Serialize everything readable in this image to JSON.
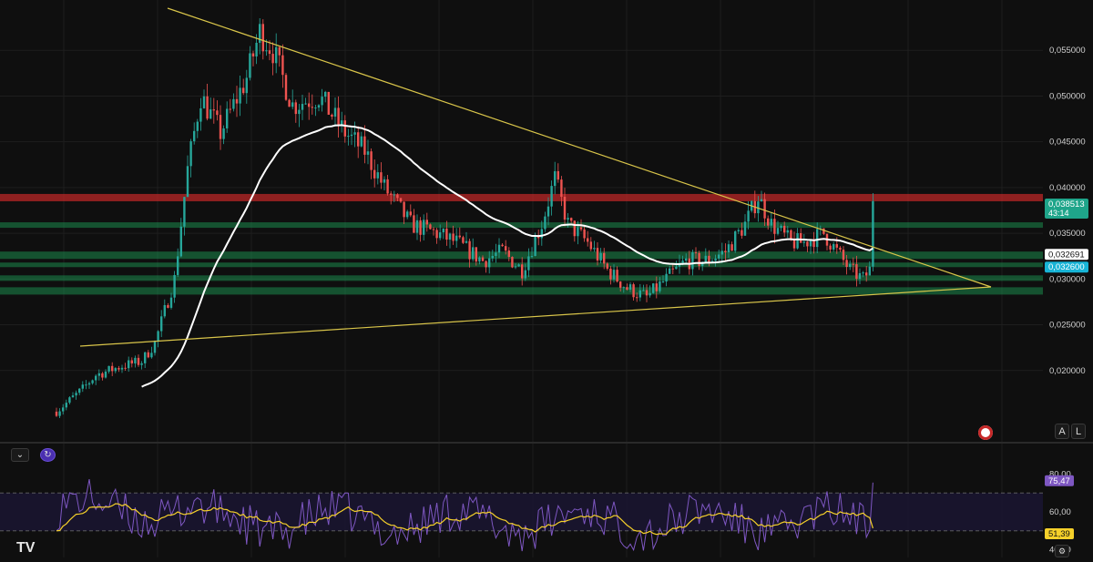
{
  "colors": {
    "background": "#0f0f0f",
    "grid": "#1e1e1e",
    "up": "#26a69a",
    "down": "#ef5350",
    "trendline": "#d9c54a",
    "ma": "#ffffff",
    "resistance_band": "#c62828",
    "support_band": "#1b8a4c",
    "rsi_line": "#7e57c2",
    "rsi_ma": "#f5d02a",
    "rsi_band": "#1a1530",
    "price_tag": "#1fa58a",
    "price_tag_blue": "#18b4d6",
    "rsi_tag": "#7e57c2",
    "rsi_ma_tag": "#f5d02a"
  },
  "price_axis": {
    "ticks": [
      "0,055000",
      "0,050000",
      "0,045000",
      "0,040000",
      "0,035000",
      "0,030000",
      "0,025000",
      "0,020000"
    ],
    "tick_values": [
      0.055,
      0.05,
      0.045,
      0.04,
      0.035,
      0.03,
      0.025,
      0.02
    ],
    "current_price": "0,038513",
    "countdown": "43:14",
    "ma_value": "0,032691",
    "level_value": "0,032600"
  },
  "rsi_axis": {
    "ticks": [
      "80,00",
      "60,00",
      "40,00"
    ],
    "tick_values": [
      80,
      60,
      40
    ],
    "rsi_value": "75,47",
    "rsi_ma_value": "51,39"
  },
  "buttons": {
    "auto": "A",
    "log": "L",
    "collapse": "⌄",
    "indicator": "↻"
  },
  "chart_data": {
    "type": "candlestick",
    "ylim": [
      0.0145,
      0.0605
    ],
    "bars": 250,
    "resistance_zone": [
      0.0385,
      0.0393
    ],
    "support_zones": [
      [
        0.0356,
        0.0362
      ],
      [
        0.0322,
        0.033
      ],
      [
        0.0313,
        0.0318
      ],
      [
        0.0298,
        0.0304
      ],
      [
        0.0283,
        0.0291
      ]
    ],
    "trendline_upper": {
      "from": [
        0,
        0.0595
      ],
      "to": [
        252,
        0.029
      ]
    },
    "trendline_lower": {
      "from": [
        0,
        0.023
      ],
      "to": [
        252,
        0.029
      ]
    },
    "key_prices": {
      "start": 0.0155,
      "breakout_high": 0.0595,
      "consolidation_low": 0.0265,
      "last_close": 0.038513
    },
    "moving_average_last": 0.032691,
    "rsi": {
      "overbought_line": 70,
      "oversold_line": 50,
      "ylim": [
        36,
        84
      ],
      "last": 75.47,
      "ma_last": 51.39
    }
  }
}
